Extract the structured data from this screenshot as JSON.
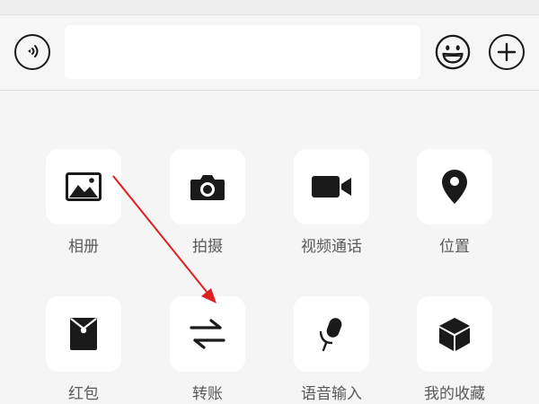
{
  "input_bar": {
    "text_value": "",
    "voice_icon": "voice-icon",
    "emoji_icon": "emoji-icon",
    "plus_icon": "plus-icon"
  },
  "panel": {
    "items": [
      {
        "label": "相册",
        "icon": "photo-album-icon"
      },
      {
        "label": "拍摄",
        "icon": "camera-icon"
      },
      {
        "label": "视频通话",
        "icon": "video-call-icon"
      },
      {
        "label": "位置",
        "icon": "location-pin-icon"
      },
      {
        "label": "红包",
        "icon": "red-packet-icon"
      },
      {
        "label": "转账",
        "icon": "transfer-icon"
      },
      {
        "label": "语音输入",
        "icon": "microphone-icon"
      },
      {
        "label": "我的收藏",
        "icon": "favorites-cube-icon"
      }
    ]
  },
  "annotation": {
    "color": "#e02020",
    "from_item": "相册",
    "to_item": "转账"
  }
}
